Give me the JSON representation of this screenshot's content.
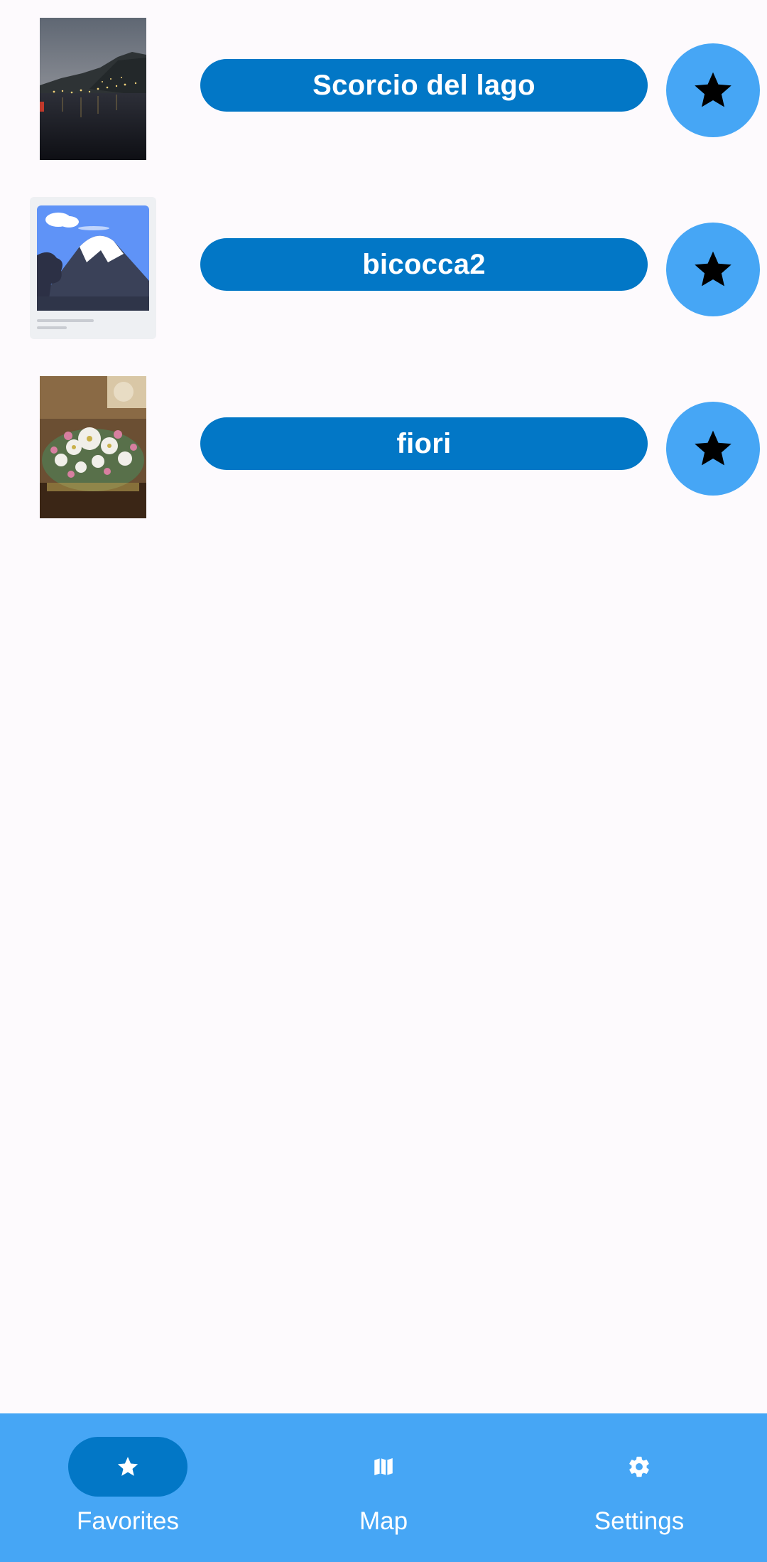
{
  "favorites": [
    {
      "title": "Scorcio del lago",
      "thumbnail": "lake-night-photo",
      "favorited": true
    },
    {
      "title": "bicocca2",
      "thumbnail": "image-placeholder-illustration",
      "favorited": true
    },
    {
      "title": "fiori",
      "thumbnail": "flowers-bouquet-photo",
      "favorited": true
    }
  ],
  "bottom_nav": {
    "items": [
      {
        "label": "Favorites",
        "icon": "star-icon",
        "active": true
      },
      {
        "label": "Map",
        "icon": "map-icon",
        "active": false
      },
      {
        "label": "Settings",
        "icon": "gear-icon",
        "active": false
      }
    ]
  },
  "colors": {
    "background": "#fdfafd",
    "primary": "#0277c6",
    "accent": "#46a6f5",
    "on_primary": "#ffffff"
  }
}
